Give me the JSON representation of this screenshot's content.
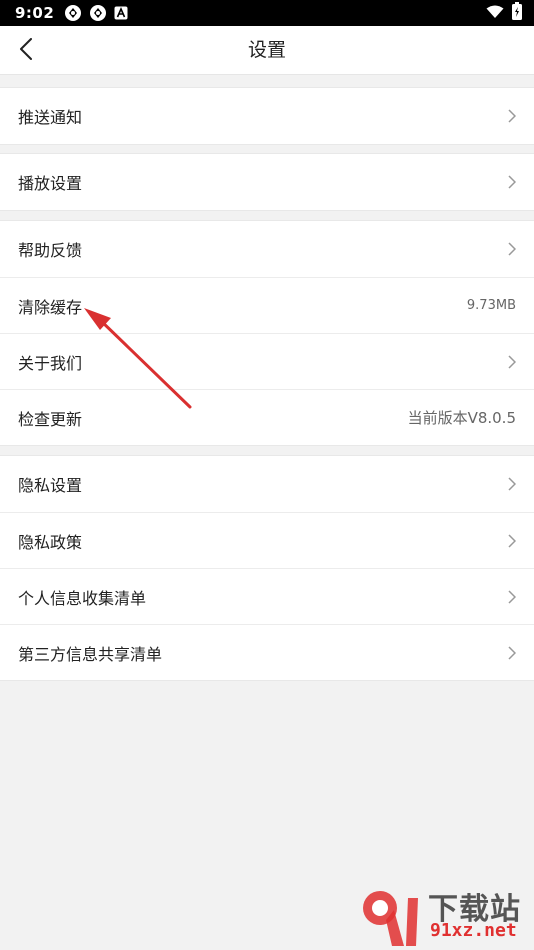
{
  "status_bar": {
    "time": "9:02",
    "icons": [
      "notification-icon",
      "notification-icon",
      "app-icon"
    ],
    "right_icons": [
      "wifi-icon",
      "battery-icon"
    ]
  },
  "header": {
    "title": "设置",
    "back_icon": "back-arrow-icon"
  },
  "groups": [
    {
      "items": [
        {
          "label": "推送通知"
        }
      ]
    },
    {
      "items": [
        {
          "label": "播放设置"
        }
      ]
    },
    {
      "items": [
        {
          "label": "帮助反馈"
        },
        {
          "label": "清除缓存",
          "value": "9.73MB"
        },
        {
          "label": "关于我们"
        },
        {
          "label": "检查更新",
          "value": "当前版本V8.0.5"
        }
      ]
    },
    {
      "items": [
        {
          "label": "隐私设置"
        },
        {
          "label": "隐私政策"
        },
        {
          "label": "个人信息收集清单"
        },
        {
          "label": "第三方信息共享清单"
        }
      ]
    }
  ],
  "watermark": {
    "title": "下载站",
    "site": "91xz.net",
    "logo_mark": "9"
  },
  "colors": {
    "annotation_arrow": "#d93030",
    "watermark_red": "#e03030"
  }
}
